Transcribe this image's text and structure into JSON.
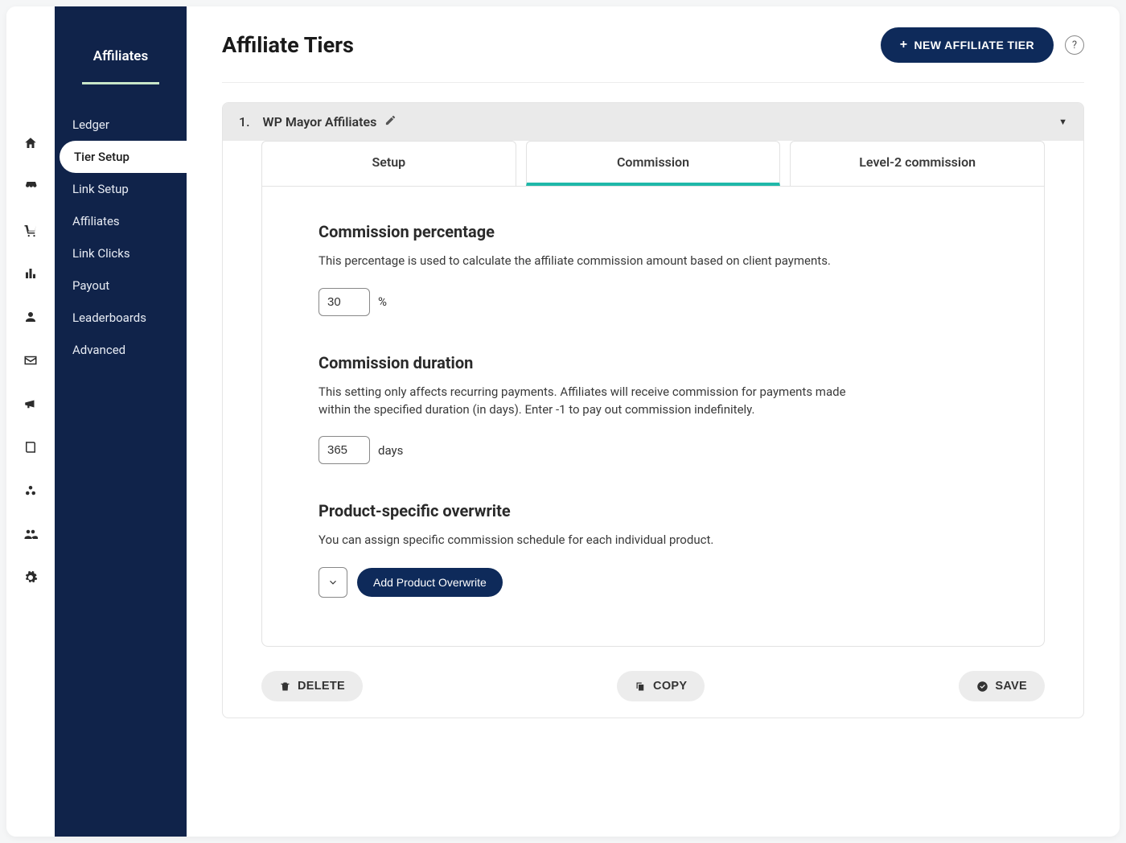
{
  "sidebar": {
    "title": "Affiliates",
    "items": [
      {
        "label": "Ledger"
      },
      {
        "label": "Tier Setup",
        "active": true
      },
      {
        "label": "Link Setup"
      },
      {
        "label": "Affiliates"
      },
      {
        "label": "Link Clicks"
      },
      {
        "label": "Payout"
      },
      {
        "label": "Leaderboards"
      },
      {
        "label": "Advanced"
      }
    ]
  },
  "iconrail": [
    "home-icon",
    "store-icon",
    "cart-icon",
    "chart-icon",
    "user-icon",
    "mail-icon",
    "megaphone-icon",
    "book-icon",
    "circles-icon",
    "people-icon",
    "gear-icon"
  ],
  "header": {
    "title": "Affiliate Tiers",
    "new_button": "NEW AFFILIATE TIER",
    "help": "?"
  },
  "tier": {
    "number": "1.",
    "name": "WP Mayor Affiliates",
    "tabs": {
      "setup": "Setup",
      "commission": "Commission",
      "level2": "Level-2 commission"
    },
    "commission_percentage": {
      "title": "Commission percentage",
      "desc": "This percentage is used to calculate the affiliate commission amount based on client payments.",
      "value": "30",
      "unit": "%"
    },
    "commission_duration": {
      "title": "Commission duration",
      "desc": "This setting only affects recurring payments. Affiliates will receive commission for payments made within the specified duration (in days). Enter -1 to pay out commission indefinitely.",
      "value": "365",
      "unit": "days"
    },
    "product_overwrite": {
      "title": "Product-specific overwrite",
      "desc": "You can assign specific commission schedule for each individual product.",
      "button": "Add Product Overwrite"
    }
  },
  "footer": {
    "delete": "DELETE",
    "copy": "COPY",
    "save": "SAVE"
  }
}
